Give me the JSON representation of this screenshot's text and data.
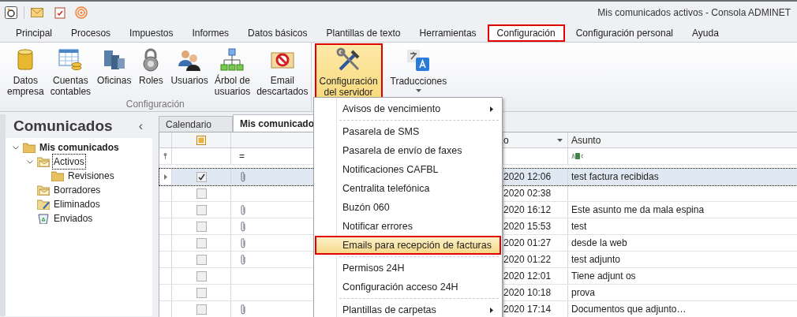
{
  "window": {
    "title": "Mis comunicados activos - Consola ADMINET"
  },
  "ribbon_tabs": [
    {
      "label": "Principal",
      "selected": false
    },
    {
      "label": "Procesos",
      "selected": false
    },
    {
      "label": "Impuestos",
      "selected": false
    },
    {
      "label": "Informes",
      "selected": false
    },
    {
      "label": "Datos básicos",
      "selected": false
    },
    {
      "label": "Plantillas de texto",
      "selected": false
    },
    {
      "label": "Herramientas",
      "selected": false
    },
    {
      "label": "Configuración",
      "selected": true
    },
    {
      "label": "Configuración personal",
      "selected": false
    },
    {
      "label": "Ayuda",
      "selected": false
    }
  ],
  "ribbon": {
    "group_label": "Configuración",
    "group_buttons": [
      {
        "label": "Datos\nempresa"
      },
      {
        "label": "Cuentas\ncontables"
      },
      {
        "label": "Oficinas"
      },
      {
        "label": "Roles"
      },
      {
        "label": "Usuarios"
      },
      {
        "label": "Árbol de\nusuarios"
      },
      {
        "label": "Email\ndescartados"
      }
    ],
    "extra_buttons": [
      {
        "label": "Configuración\ndel servidor",
        "highlighted": true,
        "has_dropdown": true
      },
      {
        "label": "Traducciones",
        "highlighted": false,
        "has_dropdown": true
      }
    ]
  },
  "menu": [
    {
      "kind": "item",
      "label": "Avisos de vencimiento",
      "submenu": true,
      "highlighted": false
    },
    {
      "kind": "separator"
    },
    {
      "kind": "item",
      "label": "Pasarela de SMS",
      "submenu": false,
      "highlighted": false
    },
    {
      "kind": "item",
      "label": "Pasarela de envío de faxes",
      "submenu": false,
      "highlighted": false
    },
    {
      "kind": "item",
      "label": "Notificaciones CAFBL",
      "submenu": false,
      "highlighted": false
    },
    {
      "kind": "item",
      "label": "Centralita telefónica",
      "submenu": false,
      "highlighted": false
    },
    {
      "kind": "item",
      "label": "Buzón 060",
      "submenu": false,
      "highlighted": false
    },
    {
      "kind": "item",
      "label": "Notificar errores",
      "submenu": false,
      "highlighted": false
    },
    {
      "kind": "item",
      "label": "Emails para recepción de facturas",
      "submenu": false,
      "highlighted": true
    },
    {
      "kind": "separator"
    },
    {
      "kind": "item",
      "label": "Permisos 24H",
      "submenu": false,
      "highlighted": false
    },
    {
      "kind": "item",
      "label": "Configuración acceso 24H",
      "submenu": false,
      "highlighted": false
    },
    {
      "kind": "separator"
    },
    {
      "kind": "item",
      "label": "Plantillas de carpetas",
      "submenu": true,
      "highlighted": false
    }
  ],
  "sidebar": {
    "title": "Comunicados",
    "collapse_glyph": "‹",
    "tree": [
      {
        "label": "Mis comunicados",
        "expanded": true,
        "selected": false,
        "children": [
          {
            "label": "Activos",
            "expanded": true,
            "selected": true,
            "children": [
              {
                "label": "Revisiones",
                "selected": false
              }
            ]
          },
          {
            "label": "Borradores",
            "selected": false
          },
          {
            "label": "Eliminados",
            "selected": false
          },
          {
            "label": "Enviados",
            "selected": false
          }
        ]
      }
    ]
  },
  "doc_tabs": [
    {
      "label": "Calendario",
      "selected": false
    },
    {
      "label": "Mis comunicado",
      "selected": true
    }
  ],
  "grid": {
    "columns": [
      {
        "label": "o",
        "sorted": true
      },
      {
        "label": "Asunto",
        "sorted": false
      }
    ],
    "filter_attachment": "=",
    "rows": [
      {
        "checked": true,
        "attachment": true,
        "column_3": "2020 12:06",
        "subject": "test factura recibidas",
        "selected": true
      },
      {
        "checked": false,
        "attachment": false,
        "column_3": "2020 02:38",
        "selected": false
      },
      {
        "checked": false,
        "attachment": true,
        "column_3": "2020 16:12",
        "subject": "Este asunto me da mala espina",
        "selected": false
      },
      {
        "checked": false,
        "attachment": true,
        "column_3": "2020 15:53",
        "subject": "test",
        "selected": false
      },
      {
        "checked": false,
        "attachment": true,
        "column_3": "2020 01:27",
        "subject": "desde la web",
        "selected": false
      },
      {
        "checked": false,
        "attachment": true,
        "column_3": "2020 01:22",
        "subject": "test adjunto",
        "selected": false
      },
      {
        "checked": false,
        "attachment": false,
        "column_3": "2020 12:01",
        "subject": "Tiene adjunt os",
        "selected": false
      },
      {
        "checked": false,
        "attachment": false,
        "column_3": "2020 10:18",
        "subject": "prova",
        "selected": false
      },
      {
        "checked": false,
        "attachment": true,
        "column_3": "2020 17:14",
        "subject": "Documentos que adjunto…",
        "selected": false
      }
    ]
  }
}
